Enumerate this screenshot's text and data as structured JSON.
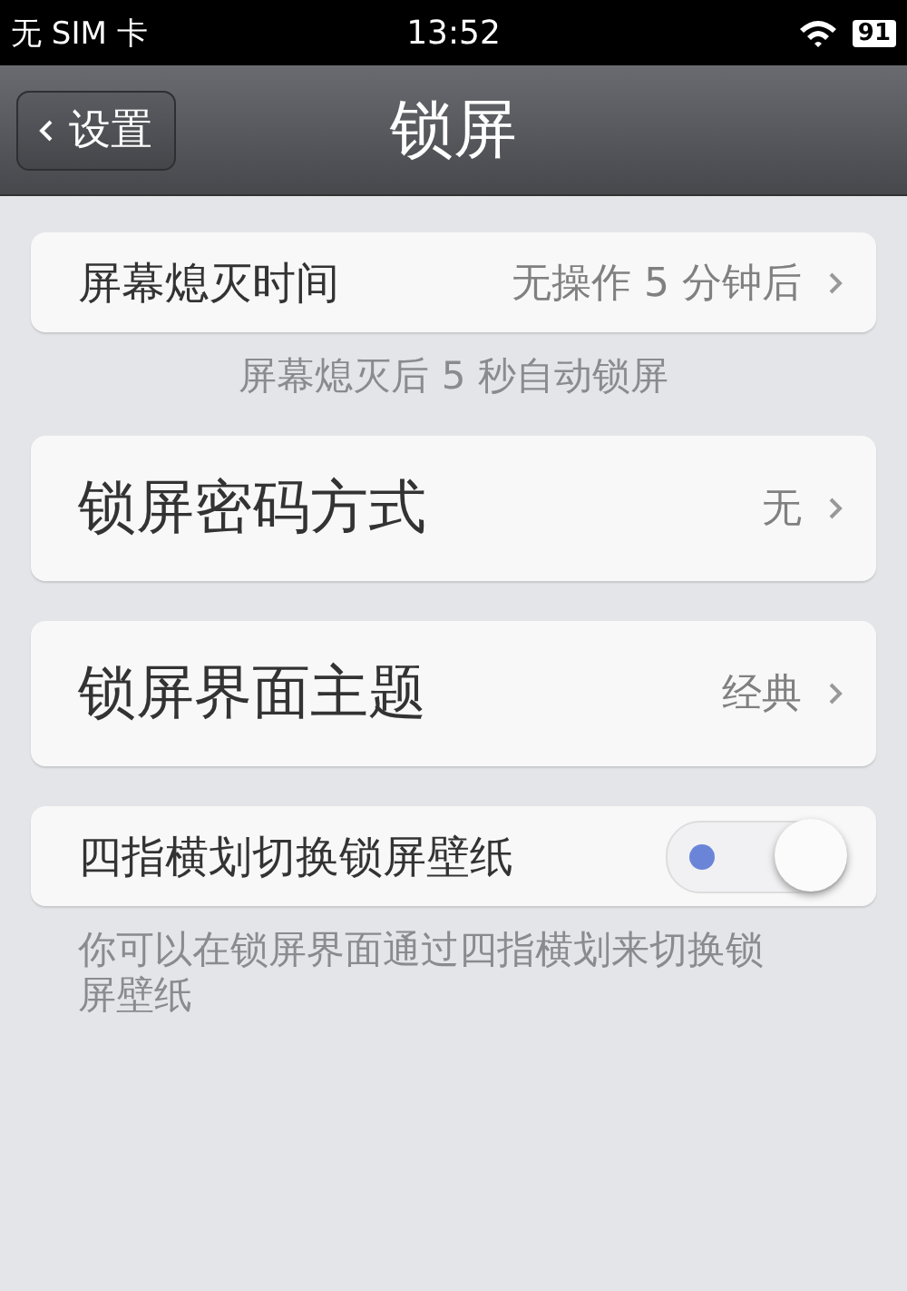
{
  "status_bar": {
    "carrier": "无 SIM 卡",
    "time": "13:52",
    "battery": "91"
  },
  "nav_bar": {
    "back_label": "设置",
    "title": "锁屏"
  },
  "rows": [
    {
      "kind": "link",
      "label": "屏幕熄灭时间",
      "value": "无操作 5 分钟后",
      "note": "屏幕熄灭后 5 秒自动锁屏"
    },
    {
      "kind": "link",
      "label": "锁屏密码方式",
      "value": "无"
    },
    {
      "kind": "link",
      "label": "锁屏界面主题",
      "value": "经典"
    },
    {
      "kind": "toggle",
      "label": "四指横划切换锁屏壁纸",
      "on": true,
      "note": "你可以在锁屏界面通过四指横划来切换锁屏壁纸"
    }
  ]
}
